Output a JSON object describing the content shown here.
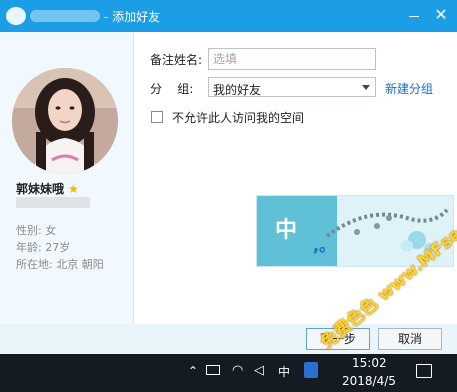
{
  "window": {
    "title": "- 添加好友",
    "close_label": "✕"
  },
  "profile": {
    "nickname": "郭妹妹哦",
    "gender_line": "性别: 女",
    "age_line": "年龄: 27岁",
    "location_line": "所在地: 北京  朝阳"
  },
  "form": {
    "remark_label": "备注姓名:",
    "remark_value": "",
    "remark_placeholder": "选填",
    "group_label": "分    组:",
    "group_value": "我的好友",
    "new_group_link": "新建分组",
    "space_checkbox_label": "不允许此人访问我的空间",
    "space_checkbox_checked": false
  },
  "ime_popup": {
    "mode_char": "中",
    "punct": ",。"
  },
  "buttons": {
    "next": "下一步",
    "cancel": "取消"
  },
  "taskbar": {
    "ime_indicator": "中",
    "time": "15:02",
    "date": "2018/4/5"
  },
  "watermark": {
    "text": "免费色色 www.MFsese.com"
  },
  "colors": {
    "title_bar": "#1b9ee6",
    "left_panel": "#f2f9fe",
    "link": "#1a6fc4",
    "star": "#f2b705",
    "taskbar": "#141b22",
    "watermark": "#ffd32a"
  },
  "icons": {
    "app_logo": "qq-logo-icon",
    "minimize": "minimize-icon",
    "close": "close-icon",
    "select_arrow": "chevron-down-icon",
    "vip_star": "star-icon",
    "tray": [
      "chevron-up-icon",
      "battery-icon",
      "wifi-icon",
      "volume-icon",
      "shield-icon",
      "notification-icon"
    ]
  }
}
